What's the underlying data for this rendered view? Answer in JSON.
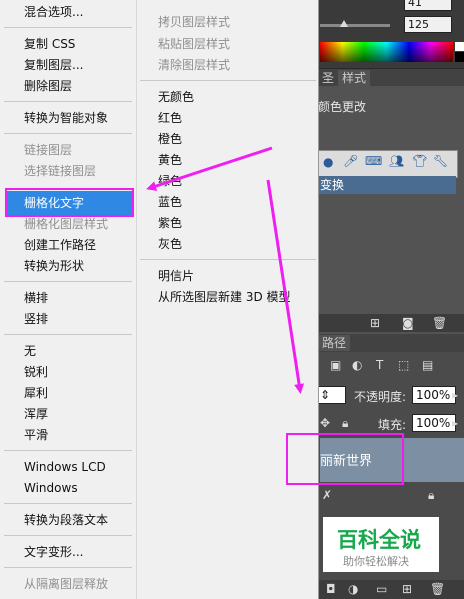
{
  "menu": {
    "left": [
      {
        "label": "混合选项...",
        "disabled": false
      },
      {
        "label": "复制 CSS",
        "disabled": false
      },
      {
        "label": "复制图层...",
        "disabled": false
      },
      {
        "label": "删除图层",
        "disabled": false
      },
      {
        "label": "转换为智能对象",
        "disabled": false
      },
      {
        "label": "链接图层",
        "disabled": true
      },
      {
        "label": "选择链接图层",
        "disabled": true
      },
      {
        "label": "栅格化文字",
        "disabled": false,
        "highlighted": true
      },
      {
        "label": "栅格化图层样式",
        "disabled": true
      },
      {
        "label": "创建工作路径",
        "disabled": false
      },
      {
        "label": "转换为形状",
        "disabled": false
      },
      {
        "label": "横排",
        "disabled": false
      },
      {
        "label": "竖排",
        "disabled": false
      },
      {
        "label": "无",
        "disabled": false
      },
      {
        "label": "锐利",
        "disabled": false
      },
      {
        "label": "犀利",
        "disabled": false
      },
      {
        "label": "浑厚",
        "disabled": false
      },
      {
        "label": "平滑",
        "disabled": false
      },
      {
        "label": "Windows LCD",
        "disabled": false
      },
      {
        "label": "Windows",
        "disabled": false
      },
      {
        "label": "转换为段落文本",
        "disabled": false
      },
      {
        "label": "文字变形...",
        "disabled": false
      },
      {
        "label": "从隔离图层释放",
        "disabled": true
      }
    ],
    "right": [
      {
        "label": "拷贝图层样式",
        "disabled": true
      },
      {
        "label": "粘贴图层样式",
        "disabled": true
      },
      {
        "label": "清除图层样式",
        "disabled": true
      },
      {
        "label": "无颜色",
        "disabled": false
      },
      {
        "label": "红色",
        "disabled": false
      },
      {
        "label": "橙色",
        "disabled": false
      },
      {
        "label": "黄色",
        "disabled": false
      },
      {
        "label": "绿色",
        "disabled": false
      },
      {
        "label": "蓝色",
        "disabled": false
      },
      {
        "label": "紫色",
        "disabled": false
      },
      {
        "label": "灰色",
        "disabled": false
      },
      {
        "label": "明信片",
        "disabled": false
      },
      {
        "label": "从所选图层新建 3D 模型",
        "disabled": false
      }
    ]
  },
  "panels": {
    "top_value_1": "41",
    "top_value_2": "125",
    "tab_styles": "样式",
    "styles_row": "颜色更改",
    "selected_row": "变换",
    "layers_tab": "路径",
    "opacity_label": "不透明度:",
    "opacity_value": "100%",
    "fill_label": "填充:",
    "fill_value": "100%",
    "layer_name": "丽新世界"
  },
  "watermark": {
    "title": "百科全说",
    "subtitle": "助你轻松解决"
  },
  "colors": {
    "highlight": "#2e88e4",
    "annotation": "#ee1ff0",
    "menu_bg": "#f0f0f0",
    "panel_bg": "#535353"
  }
}
